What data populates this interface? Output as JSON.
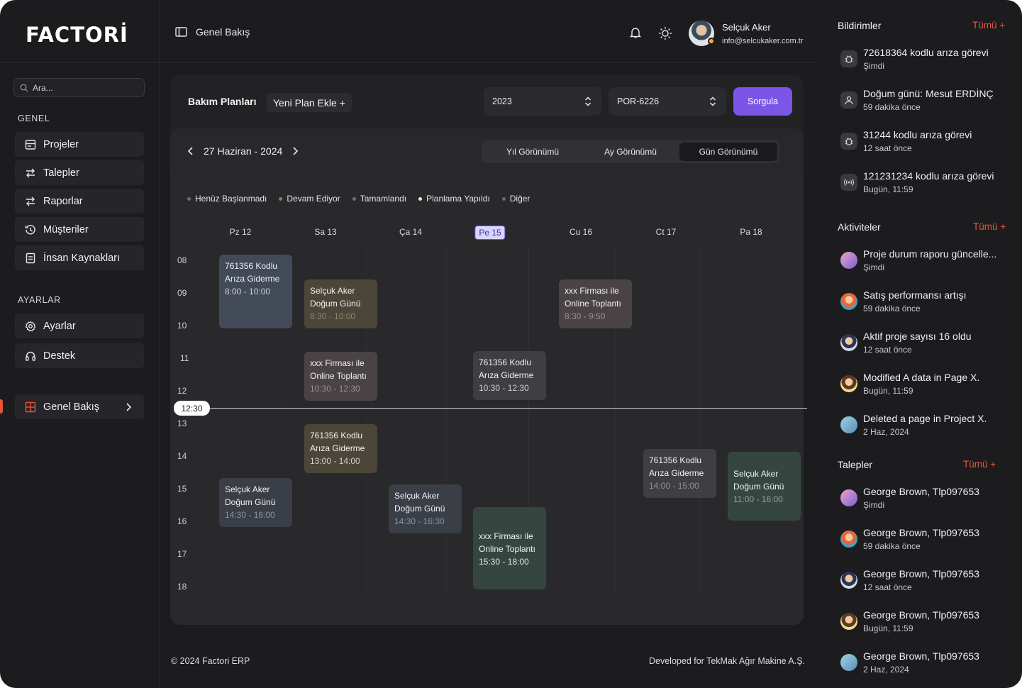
{
  "brand": {
    "logo_text": "FACTORİ",
    "accent": "#e8533a",
    "primary": "#7a55e6"
  },
  "sidebar": {
    "search_placeholder": "Ara...",
    "section_general": "GENEL",
    "section_settings": "AYARLAR",
    "general_items": [
      {
        "label": "Projeler",
        "icon": "folder-icon"
      },
      {
        "label": "Talepler",
        "icon": "swap-icon"
      },
      {
        "label": "Raporlar",
        "icon": "swap-icon"
      },
      {
        "label": "Müşteriler",
        "icon": "history-icon"
      },
      {
        "label": "İnsan Kaynakları",
        "icon": "document-icon"
      }
    ],
    "settings_items": [
      {
        "label": "Ayarlar",
        "icon": "gear-icon"
      },
      {
        "label": "Destek",
        "icon": "headset-icon"
      }
    ],
    "active_item": {
      "label": "Genel Bakış",
      "icon": "grid-icon"
    }
  },
  "header": {
    "title": "Genel Bakış",
    "user_name": "Selçuk Aker",
    "user_email": "info@selcukaker.com.tr"
  },
  "toolbar": {
    "title": "Bakım Planları",
    "add_label": "Yeni Plan Ekle +",
    "year_value": "2023",
    "code_value": "POR-6226",
    "query_label": "Sorgula"
  },
  "calendar": {
    "date_label": "27 Haziran - 2024",
    "views": [
      "Yıl Görünümü",
      "Ay Görünümü",
      "Gün Görünümü"
    ],
    "active_view": "Gün Görünümü",
    "legend": [
      {
        "label": "Henüz Başlanmadı",
        "color": "#6d6d72"
      },
      {
        "label": "Devam Ediyor",
        "color": "#8a8270"
      },
      {
        "label": "Tamamlandı",
        "color": "#5e7a6c"
      },
      {
        "label": "Planlama Yapıldı",
        "color": "#f0e6d2"
      },
      {
        "label": "Diğer",
        "color": "#6a6a70"
      }
    ],
    "days": [
      "Pz 12",
      "Sa 13",
      "Ça 14",
      "Pe 15",
      "Cu 16",
      "Ct 17",
      "Pa 18"
    ],
    "today": "Pe 15",
    "hours": [
      "08",
      "09",
      "10",
      "11",
      "12",
      "13",
      "14",
      "15",
      "16",
      "17",
      "18"
    ],
    "now": "12:30",
    "events": [
      {
        "title1": "761356 Kodlu",
        "title2": "Arıza Giderme",
        "time": "8:00 - 10:00"
      },
      {
        "title1": "Selçuk Aker",
        "title2": "Doğum Günü",
        "time": "8:30 - 10:00"
      },
      {
        "title1": "xxx Firması ile",
        "title2": "Online Toplantı",
        "time": "8:30 - 9:50"
      },
      {
        "title1": "xxx Firması ile",
        "title2": "Online Toplantı",
        "time": "10:30 - 12:30"
      },
      {
        "title1": "761356 Kodlu",
        "title2": "Arıza Giderme",
        "time": "10:30 - 12:30"
      },
      {
        "title1": "761356 Kodlu",
        "title2": "Arıza Giderme",
        "time": "13:00 - 14:00"
      },
      {
        "title1": "761356 Kodlu",
        "title2": "Arıza Giderme",
        "time": "14:00 - 15:00"
      },
      {
        "title1": "Selçuk Aker",
        "title2": "Doğum Günü",
        "time": "11:00 - 16:00"
      },
      {
        "title1": "Selçuk Aker",
        "title2": "Doğum Günü",
        "time": "14:30 - 16:00"
      },
      {
        "title1": "Selçuk Aker",
        "title2": "Doğum Günü",
        "time": "14:30 - 16:30"
      },
      {
        "title1": "xxx Firması ile",
        "title2": "Online Toplantı",
        "time": "15:30 - 18:00"
      }
    ]
  },
  "footer": {
    "left": "© 2024 Factori ERP",
    "right": "Developed for TekMak Ağır Makine A.Ş."
  },
  "notifications": {
    "title": "Bildirimler",
    "all_label": "Tümü +",
    "items": [
      {
        "text": "72618364 kodlu arıza görevi",
        "time": "Şimdi",
        "icon": "bug-icon"
      },
      {
        "text": "Doğum günü: Mesut ERDİNÇ",
        "time": "59 dakika önce",
        "icon": "user-icon"
      },
      {
        "text": "31244 kodlu arıza görevi",
        "time": "12 saat önce",
        "icon": "bug-icon"
      },
      {
        "text": "121231234 kodlu arıza görevi",
        "time": "Bugün, 11:59",
        "icon": "broadcast-icon"
      }
    ]
  },
  "activities": {
    "title": "Aktiviteler",
    "all_label": "Tümü +",
    "items": [
      {
        "text": "Proje durum raporu güncelle...",
        "time": "Şimdi",
        "icon": "avatar-icon"
      },
      {
        "text": "Satış performansı artışı",
        "time": "59 dakika önce",
        "icon": "avatar-icon"
      },
      {
        "text": "Aktif proje sayısı 16 oldu",
        "time": "12 saat önce",
        "icon": "avatar-icon"
      },
      {
        "text": "Modified A data in Page X.",
        "time": "Bugün, 11:59",
        "icon": "avatar-icon"
      },
      {
        "text": "Deleted a page in Project X.",
        "time": "2 Haz, 2024",
        "icon": "avatar-icon"
      }
    ]
  },
  "requests": {
    "title": "Talepler",
    "all_label": "Tümü +",
    "items": [
      {
        "text": "George Brown, Tlp097653",
        "time": "Şimdi",
        "icon": "avatar-icon"
      },
      {
        "text": "George Brown, Tlp097653",
        "time": "59 dakika önce",
        "icon": "avatar-icon"
      },
      {
        "text": "George Brown, Tlp097653",
        "time": "12 saat önce",
        "icon": "avatar-icon"
      },
      {
        "text": "George Brown, Tlp097653",
        "time": "Bugün, 11:59",
        "icon": "avatar-icon"
      },
      {
        "text": "George Brown, Tlp097653",
        "time": "2 Haz, 2024",
        "icon": "avatar-icon"
      }
    ]
  }
}
